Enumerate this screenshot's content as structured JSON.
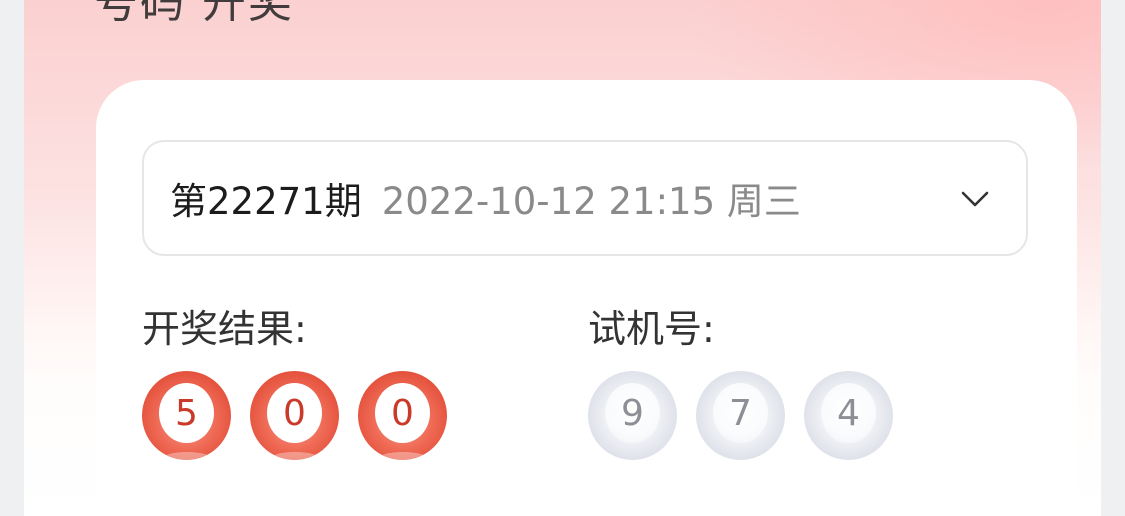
{
  "header": {
    "title": "号码 开奖"
  },
  "issue_select": {
    "issue_no": "第22271期",
    "datetime": "2022-10-12 21:15 周三",
    "chevron_icon": "chevron-down-icon"
  },
  "draw_result": {
    "label": "开奖结果:",
    "numbers": [
      "5",
      "0",
      "0"
    ],
    "ball_color": "#e3503b"
  },
  "test_numbers": {
    "label": "试机号:",
    "numbers": [
      "9",
      "7",
      "4"
    ],
    "ball_color": "#dfe2ea"
  }
}
